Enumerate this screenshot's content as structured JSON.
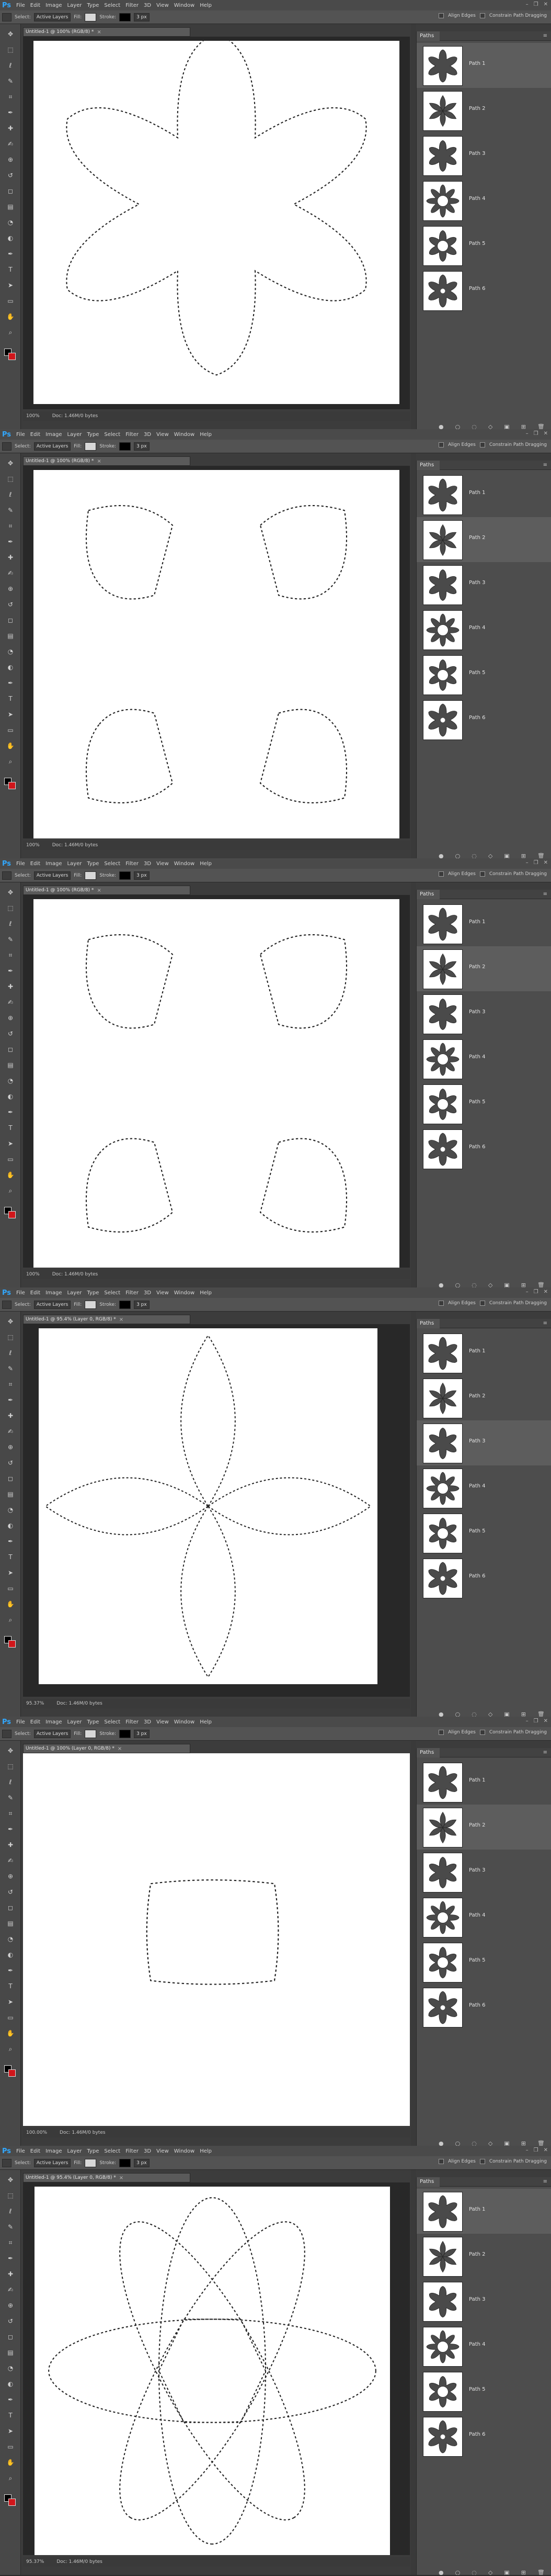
{
  "app": {
    "logo": "Ps",
    "menus": [
      "File",
      "Edit",
      "Image",
      "Layer",
      "Type",
      "Select",
      "Filter",
      "3D",
      "View",
      "Window",
      "Help"
    ],
    "window_controls": [
      "–",
      "❐",
      "✕"
    ]
  },
  "options_bar": {
    "select_label": "Select:",
    "select_value": "Active Layers",
    "fill_label": "Fill:",
    "stroke_label": "Stroke:",
    "stroke_width": "3 px",
    "align_edges_label": "Align Edges",
    "constrain_label": "Constrain Path Dragging"
  },
  "paths_panel": {
    "title": "Paths",
    "menu_icon": "panel-menu-icon",
    "items": [
      {
        "name": "Path 1"
      },
      {
        "name": "Path 2"
      },
      {
        "name": "Path 3"
      },
      {
        "name": "Path 4"
      },
      {
        "name": "Path 5"
      },
      {
        "name": "Path 6"
      }
    ],
    "footer_icons": [
      "fill-path-icon",
      "stroke-path-icon",
      "load-selection-icon",
      "make-work-path-icon",
      "add-mask-icon",
      "new-path-icon",
      "delete-path-icon"
    ]
  },
  "frames": [
    {
      "tab_title": "Untitled-1 @ 100% (RGB/8) *",
      "zoom": "100%",
      "doc_info": "Doc: 1.46M/0 bytes",
      "selected_path": 0,
      "canvas_shape": "flower"
    },
    {
      "tab_title": "Untitled-1 @ 100% (RGB/8) *",
      "zoom": "100%",
      "doc_info": "Doc: 1.46M/0 bytes",
      "selected_path": 1,
      "canvas_shape": "four-petals"
    },
    {
      "tab_title": "Untitled-1 @ 100% (RGB/8) *",
      "zoom": "100%",
      "doc_info": "Doc: 1.46M/0 bytes",
      "selected_path": 1,
      "canvas_shape": "four-petals"
    },
    {
      "tab_title": "Untitled-1 @ 95.4% (Layer 0, RGB/8) *",
      "zoom": "95.37%",
      "doc_info": "Doc: 1.46M/0 bytes",
      "selected_path": 2,
      "canvas_shape": "cross"
    },
    {
      "tab_title": "Untitled-1 @ 100% (Layer 0, RGB/8) *",
      "zoom": "100.00%",
      "doc_info": "Doc: 1.46M/0 bytes",
      "selected_path": 1,
      "canvas_shape": "square"
    },
    {
      "tab_title": "Untitled-1 @ 95.4% (Layer 0, RGB/8) *",
      "zoom": "95.37%",
      "doc_info": "Doc: 1.46M/0 bytes",
      "selected_path": 0,
      "canvas_shape": "atom"
    }
  ],
  "tools": [
    "move-tool-icon",
    "marquee-tool-icon",
    "lasso-tool-icon",
    "quick-select-tool-icon",
    "crop-tool-icon",
    "eyedropper-tool-icon",
    "healing-tool-icon",
    "brush-tool-icon",
    "clone-stamp-tool-icon",
    "history-brush-tool-icon",
    "eraser-tool-icon",
    "gradient-tool-icon",
    "blur-tool-icon",
    "dodge-tool-icon",
    "pen-tool-icon",
    "type-tool-icon",
    "path-selection-tool-icon",
    "shape-tool-icon",
    "hand-tool-icon",
    "zoom-tool-icon"
  ],
  "colors": {
    "foreground": "#000000",
    "background": "#d0161b",
    "accent": "#31a8ff"
  }
}
